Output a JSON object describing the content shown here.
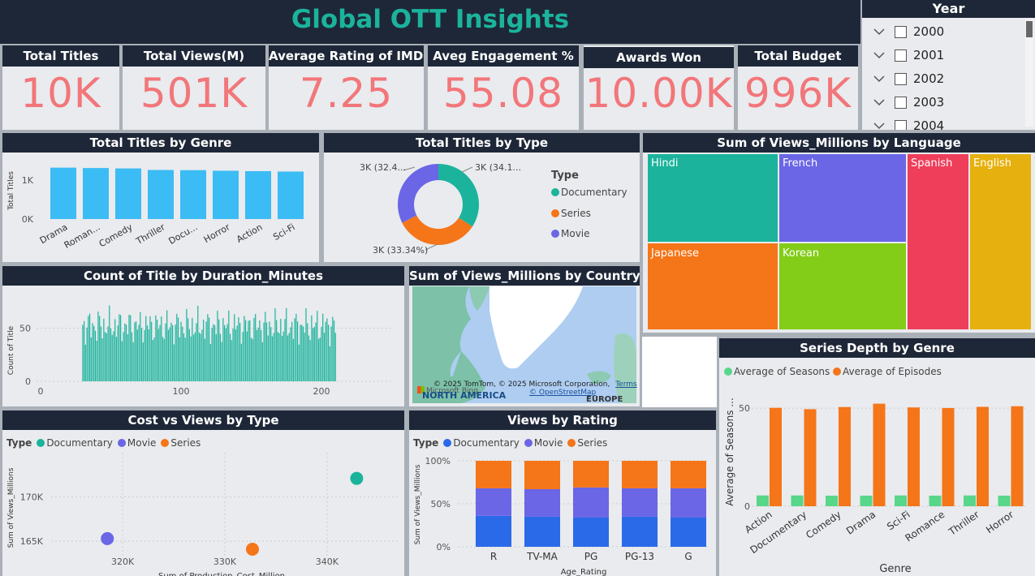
{
  "header": {
    "title": "Global OTT Insights"
  },
  "kpis": [
    {
      "label": "Total Titles",
      "value": "10K"
    },
    {
      "label": "Total Views(M)",
      "value": "501K"
    },
    {
      "label": "Average Rating of IMDB",
      "value": "7.25"
    },
    {
      "label": "Aveg Engagement %",
      "value": "55.08"
    },
    {
      "label": "Awards Won",
      "value": "10.00K"
    },
    {
      "label": "Total Budget",
      "value": "996K"
    }
  ],
  "year_slicer": {
    "title": "Year",
    "items": [
      "2000",
      "2001",
      "2002",
      "2003",
      "2004"
    ]
  },
  "genre_chart": {
    "title": "Total Titles by Genre",
    "ylabel": "Total Titles",
    "yticks": [
      "1K",
      "0K"
    ],
    "xticklabels": [
      "Drama",
      "Roman...",
      "Comedy",
      "Thriller",
      "Docu...",
      "Horror",
      "Action",
      "Sci-Fi"
    ]
  },
  "type_chart": {
    "title": "Total Titles by Type",
    "legend_title": "Type",
    "labels": [
      "3K (34.1...",
      "3K (33.34%)",
      "3K (32.4..."
    ],
    "legend": [
      "Documentary",
      "Series",
      "Movie"
    ]
  },
  "language_chart": {
    "title": "Sum of Views_Millions by Language",
    "labels": [
      "Hindi",
      "French",
      "Spanish",
      "English",
      "Japanese",
      "Korean"
    ]
  },
  "duration_chart": {
    "title": "Count of Title by Duration_Minutes",
    "ylabel": "Count of Title",
    "yticks": [
      "50",
      "0"
    ],
    "xticks": [
      "0",
      "100",
      "200"
    ]
  },
  "map": {
    "title": "Sum of Views_Millions by Country",
    "copyright": "© 2025 TomTom, © 2025 Microsoft Corporation,",
    "terms": "Terms",
    "osm": "© OpenStreetMap",
    "brand": "Microsoft Bing",
    "region1": "NORTH AMERICA",
    "region2": "EUROPE"
  },
  "series_chart": {
    "title": "Series Depth by Genre",
    "legend": [
      "Average of Seasons",
      "Average of Episodes"
    ],
    "ylabel": "Average of Seasons ...",
    "xlabel": "Genre",
    "yticks": [
      "50",
      "0"
    ]
  },
  "scatter_chart": {
    "title": "Cost vs Views by Type",
    "legend_title": "Type",
    "legend": [
      "Documentary",
      "Movie",
      "Series"
    ],
    "ylabel": "Sum of Views_Millions",
    "xlabel": "Sum of Production_Cost_Million",
    "yticks": [
      "170K",
      "165K"
    ],
    "xticks": [
      "320K",
      "330K",
      "340K"
    ]
  },
  "rating_chart": {
    "title": "Views by Rating",
    "legend_title": "Type",
    "legend": [
      "Documentary",
      "Movie",
      "Series"
    ],
    "ylabel": "Sum of Views_Millions",
    "xlabel": "Age_Rating",
    "yticks": [
      "100%",
      "50%",
      "0%"
    ]
  },
  "colors": {
    "teal": "#1bb39c",
    "orange": "#f57519",
    "purple": "#6a66e6",
    "blue": "#2a6ae8",
    "skyblue": "#3cbcf5",
    "green": "#58d68a",
    "kpi": "#f2767a",
    "header": "#1e2738"
  },
  "chart_data": [
    {
      "type": "bar",
      "title": "Total Titles by Genre",
      "ylabel": "Total Titles",
      "categories": [
        "Drama",
        "Romance",
        "Comedy",
        "Thriller",
        "Documentary",
        "Horror",
        "Action",
        "Sci-Fi"
      ],
      "values": [
        1320,
        1310,
        1300,
        1260,
        1255,
        1240,
        1230,
        1220
      ],
      "ylim": [
        0,
        1500
      ]
    },
    {
      "type": "pie",
      "title": "Total Titles by Type",
      "categories": [
        "Documentary",
        "Series",
        "Movie"
      ],
      "values": [
        34.1,
        33.34,
        32.4
      ]
    },
    {
      "type": "heatmap",
      "title": "Sum of Views_Millions by Language",
      "categories": [
        "Hindi",
        "French",
        "Japanese",
        "Korean",
        "Spanish",
        "English"
      ],
      "values": [
        86000,
        86000,
        80000,
        84000,
        84000,
        81000
      ]
    },
    {
      "type": "bar",
      "title": "Count of Title by Duration_Minutes",
      "xlabel": "",
      "ylabel": "Count of Title",
      "x_range": [
        30,
        210
      ],
      "ylim": [
        0,
        75
      ]
    },
    {
      "type": "bar",
      "title": "Series Depth by Genre",
      "xlabel": "Genre",
      "categories": [
        "Action",
        "Documentary",
        "Comedy",
        "Drama",
        "Sci-Fi",
        "Romance",
        "Thriller",
        "Horror"
      ],
      "series": [
        {
          "name": "Average of Seasons",
          "values": [
            5.5,
            5.5,
            5.4,
            5.4,
            5.5,
            5.4,
            5.5,
            5.4
          ]
        },
        {
          "name": "Average of Episodes",
          "values": [
            50.2,
            49.5,
            50.6,
            52.3,
            50.4,
            50.1,
            50.7,
            51.0
          ]
        }
      ],
      "ylim": [
        0,
        60
      ]
    },
    {
      "type": "scatter",
      "title": "Cost vs Views by Type",
      "xlabel": "Sum of Production_Cost_Million",
      "ylabel": "Sum of Views_Millions",
      "series": [
        {
          "name": "Documentary",
          "points": [
            [
              342900,
              172100
            ]
          ]
        },
        {
          "name": "Movie",
          "points": [
            [
              318500,
              165300
            ]
          ]
        },
        {
          "name": "Series",
          "points": [
            [
              332700,
              164100
            ]
          ]
        }
      ],
      "xlim": [
        313000,
        347000
      ],
      "ylim": [
        163000,
        175000
      ]
    },
    {
      "type": "bar",
      "title": "Views by Rating",
      "xlabel": "Age_Rating",
      "ylabel": "Sum of Views_Millions",
      "categories": [
        "R",
        "TV-MA",
        "PG",
        "PG-13",
        "G"
      ],
      "series": [
        {
          "name": "Documentary",
          "values": [
            36,
            35,
            34,
            35,
            34
          ]
        },
        {
          "name": "Movie",
          "values": [
            32,
            32,
            35,
            33,
            34
          ]
        },
        {
          "name": "Series",
          "values": [
            32,
            33,
            31,
            32,
            32
          ]
        }
      ],
      "ylim": [
        0,
        100
      ]
    }
  ]
}
